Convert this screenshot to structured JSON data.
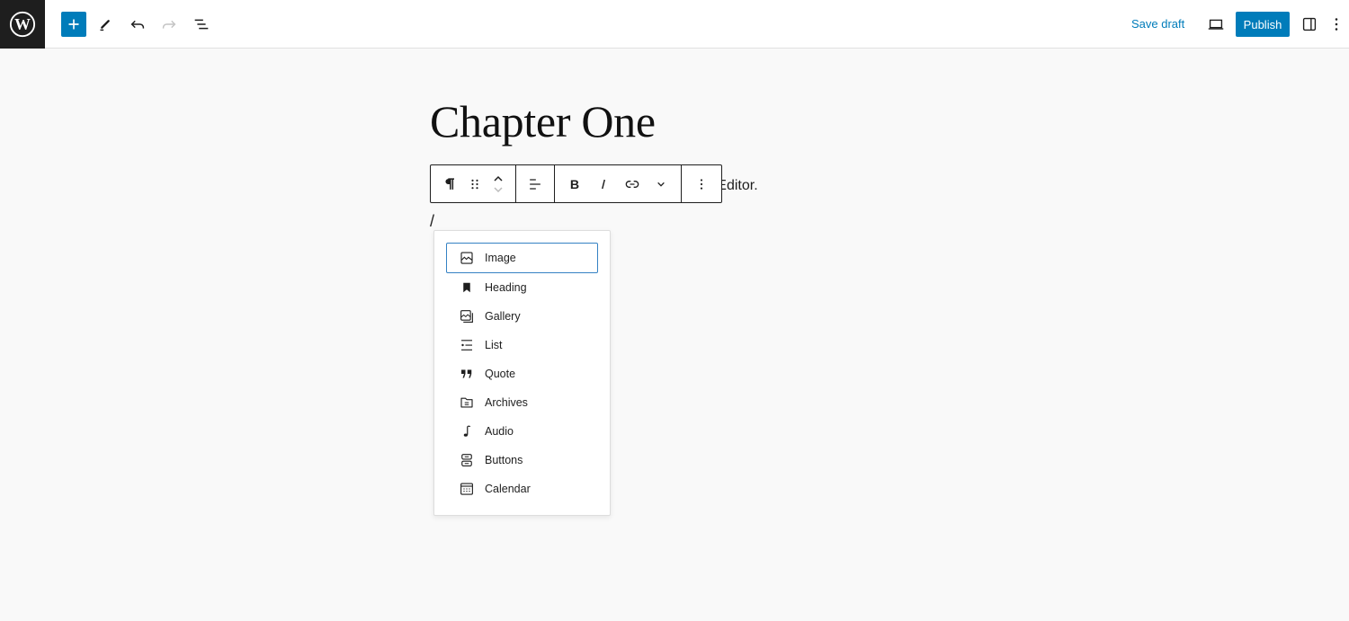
{
  "topbar": {
    "logo": "wordpress-logo",
    "add_block_icon": "plus-icon",
    "tools_icon": "pencil-icon",
    "undo_icon": "undo-icon",
    "redo_icon": "redo-icon",
    "outline_icon": "list-view-icon",
    "save_draft_label": "Save draft",
    "preview_icon": "laptop-icon",
    "publish_label": "Publish",
    "settings_icon": "sidebar-icon",
    "options_icon": "vertical-ellipsis-icon"
  },
  "editor": {
    "title": "Chapter One",
    "paragraph_visible": "raph in the Block Editor.",
    "slash_input": "/"
  },
  "block_toolbar": {
    "items": [
      "paragraph-icon",
      "drag-handle-icon",
      "move-up-icon",
      "move-down-icon",
      "align-icon",
      "bold-icon",
      "italic-icon",
      "link-icon",
      "more-rich-text-icon",
      "options-icon"
    ]
  },
  "inserter": {
    "items": [
      {
        "label": "Image",
        "icon": "image-icon",
        "selected": true
      },
      {
        "label": "Heading",
        "icon": "heading-icon"
      },
      {
        "label": "Gallery",
        "icon": "gallery-icon"
      },
      {
        "label": "List",
        "icon": "list-icon"
      },
      {
        "label": "Quote",
        "icon": "quote-icon"
      },
      {
        "label": "Archives",
        "icon": "archives-icon"
      },
      {
        "label": "Audio",
        "icon": "audio-icon"
      },
      {
        "label": "Buttons",
        "icon": "buttons-icon"
      },
      {
        "label": "Calendar",
        "icon": "calendar-icon"
      }
    ]
  },
  "colors": {
    "accent": "#007cba",
    "dark": "#1e1e1e",
    "selected_border": "#3582c4"
  }
}
